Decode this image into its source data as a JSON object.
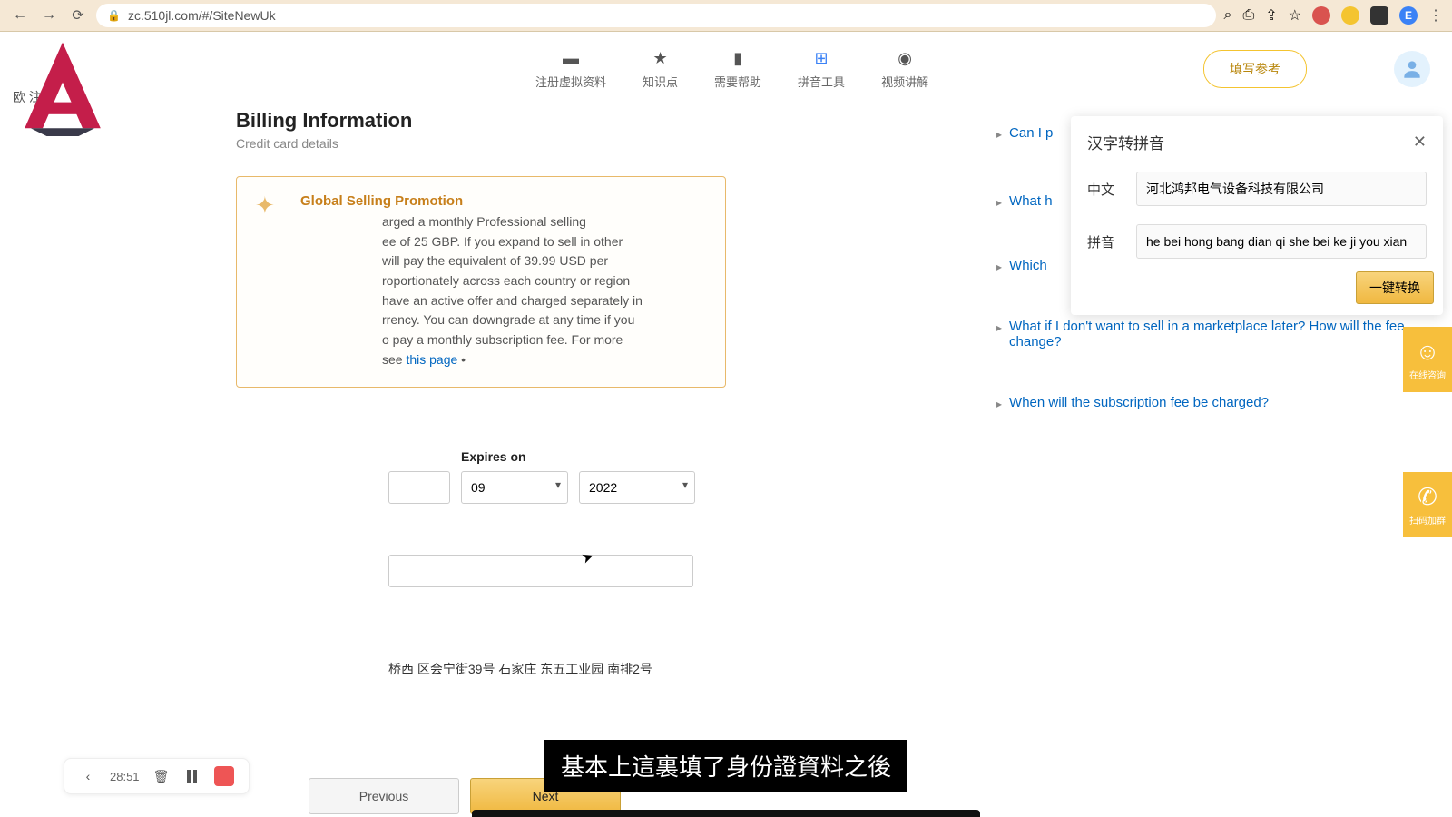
{
  "browser": {
    "url": "zc.510jl.com/#/SiteNewUk",
    "ext_letter": "E"
  },
  "header": {
    "site_label": "欧 注册",
    "nav": [
      {
        "icon": "card",
        "label": "注册虚拟资料"
      },
      {
        "icon": "star",
        "label": "知识点"
      },
      {
        "icon": "book",
        "label": "需要帮助"
      },
      {
        "icon": "puzzle",
        "label": "拼音工具"
      },
      {
        "icon": "play",
        "label": "视频讲解"
      }
    ],
    "fill_ref": "填写参考"
  },
  "billing": {
    "title": "Billing Information",
    "subtitle": "Credit card details",
    "promo_title": "Global Selling Promotion",
    "promo_text": "arged a monthly Professional selling\nee of 25 GBP. If you expand to sell in other\nwill pay the equivalent of 39.99 USD per\nroportionately across each country or region\nhave an active offer and charged separately in\nrrency. You can downgrade at any time if you\no pay a monthly subscription fee. For more\nsee ",
    "promo_link": "this page",
    "expires_label": "Expires on",
    "month": "09",
    "year": "2022",
    "address": "桥西 区会宁街39号 石家庄 东五工业园 南排2号",
    "prev_btn": "Previous",
    "next_btn": "Next"
  },
  "faq": [
    "Can I p",
    "What h",
    "Which",
    "What if I don't want to sell in a marketplace later? How will the fee change?",
    "When will the subscription fee be charged?"
  ],
  "pinyin": {
    "title": "汉字转拼音",
    "label_cn": "中文",
    "label_py": "拼音",
    "value_cn": "河北鸿邦电气设备科技有限公司",
    "value_py": "he bei hong bang dian qi she bei ke ji you xian",
    "convert_btn": "一键转换"
  },
  "float": {
    "chat": "在线咨询",
    "wechat": "扫码加群"
  },
  "video": {
    "time": "28:51"
  },
  "subtitle": "基本上這裏填了身份證資料之後"
}
